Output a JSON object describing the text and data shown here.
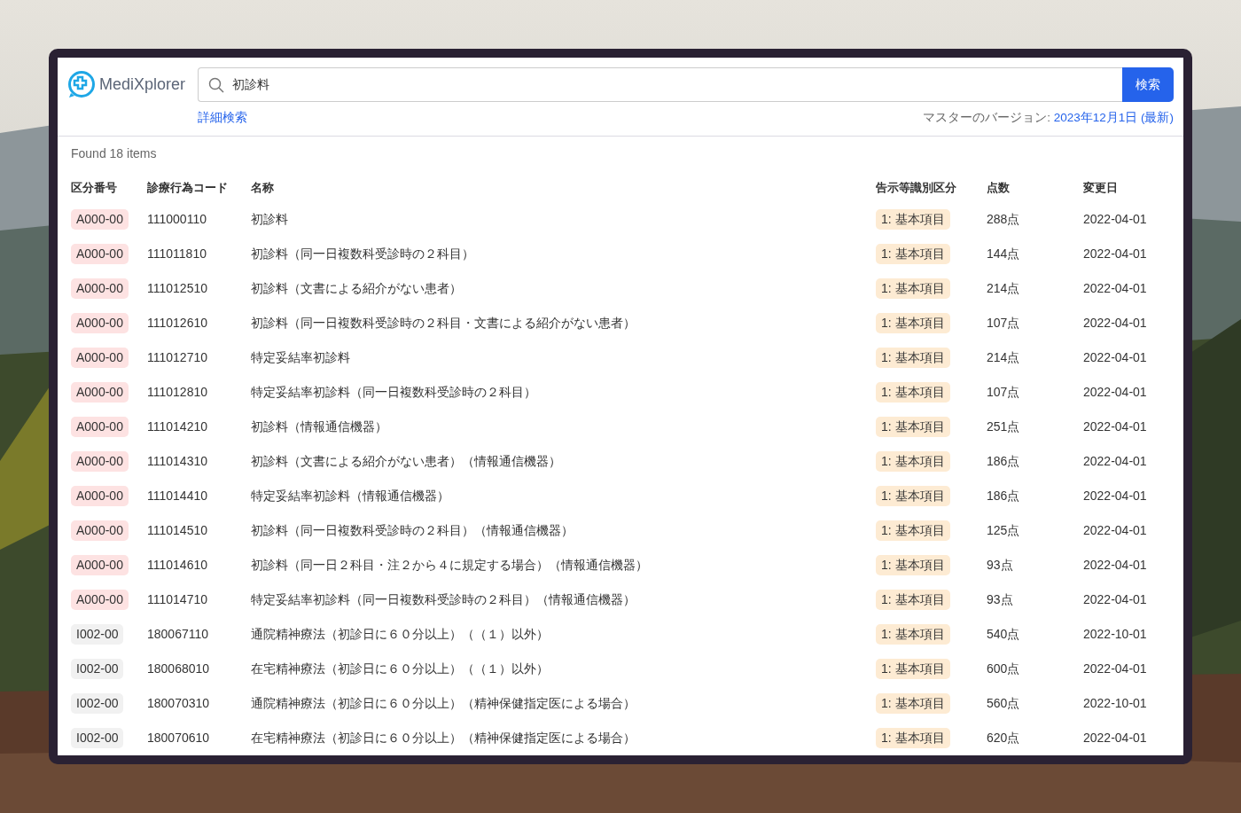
{
  "header": {
    "logo_text": "MediXplorer",
    "search": {
      "value": "初診料"
    },
    "search_button": "検索",
    "advanced_link": "詳細検索",
    "version_label": "マスターのバージョン: ",
    "version_link": "2023年12月1日 (最新)"
  },
  "result_count": "Found 18 items",
  "table": {
    "columns": [
      "区分番号",
      "診療行為コード",
      "名称",
      "告示等識別区分",
      "点数",
      "変更日"
    ],
    "rows": [
      {
        "section": "A000-00",
        "color": "#fde2e2",
        "code": "111000110",
        "name": "初診料",
        "category": "1: 基本項目",
        "points": "288点",
        "changed": "2022-04-01"
      },
      {
        "section": "A000-00",
        "color": "#fde2e2",
        "code": "111011810",
        "name": "初診料（同一日複数科受診時の２科目）",
        "category": "1: 基本項目",
        "points": "144点",
        "changed": "2022-04-01"
      },
      {
        "section": "A000-00",
        "color": "#fde2e2",
        "code": "111012510",
        "name": "初診料（文書による紹介がない患者）",
        "category": "1: 基本項目",
        "points": "214点",
        "changed": "2022-04-01"
      },
      {
        "section": "A000-00",
        "color": "#fde2e2",
        "code": "111012610",
        "name": "初診料（同一日複数科受診時の２科目・文書による紹介がない患者）",
        "category": "1: 基本項目",
        "points": "107点",
        "changed": "2022-04-01"
      },
      {
        "section": "A000-00",
        "color": "#fde2e2",
        "code": "111012710",
        "name": "特定妥結率初診料",
        "category": "1: 基本項目",
        "points": "214点",
        "changed": "2022-04-01"
      },
      {
        "section": "A000-00",
        "color": "#fde2e2",
        "code": "111012810",
        "name": "特定妥結率初診料（同一日複数科受診時の２科目）",
        "category": "1: 基本項目",
        "points": "107点",
        "changed": "2022-04-01"
      },
      {
        "section": "A000-00",
        "color": "#fde2e2",
        "code": "111014210",
        "name": "初診料（情報通信機器）",
        "category": "1: 基本項目",
        "points": "251点",
        "changed": "2022-04-01"
      },
      {
        "section": "A000-00",
        "color": "#fde2e2",
        "code": "111014310",
        "name": "初診料（文書による紹介がない患者）（情報通信機器）",
        "category": "1: 基本項目",
        "points": "186点",
        "changed": "2022-04-01"
      },
      {
        "section": "A000-00",
        "color": "#fde2e2",
        "code": "111014410",
        "name": "特定妥結率初診料（情報通信機器）",
        "category": "1: 基本項目",
        "points": "186点",
        "changed": "2022-04-01"
      },
      {
        "section": "A000-00",
        "color": "#fde2e2",
        "code": "111014510",
        "name": "初診料（同一日複数科受診時の２科目）（情報通信機器）",
        "category": "1: 基本項目",
        "points": "125点",
        "changed": "2022-04-01"
      },
      {
        "section": "A000-00",
        "color": "#fde2e2",
        "code": "111014610",
        "name": "初診料（同一日２科目・注２から４に規定する場合）（情報通信機器）",
        "category": "1: 基本項目",
        "points": "93点",
        "changed": "2022-04-01"
      },
      {
        "section": "A000-00",
        "color": "#fde2e2",
        "code": "111014710",
        "name": "特定妥結率初診料（同一日複数科受診時の２科目）（情報通信機器）",
        "category": "1: 基本項目",
        "points": "93点",
        "changed": "2022-04-01"
      },
      {
        "section": "I002-00",
        "color": "#f1f1f1",
        "code": "180067110",
        "name": "通院精神療法（初診日に６０分以上）（（１）以外）",
        "category": "1: 基本項目",
        "points": "540点",
        "changed": "2022-10-01"
      },
      {
        "section": "I002-00",
        "color": "#f1f1f1",
        "code": "180068010",
        "name": "在宅精神療法（初診日に６０分以上）（（１）以外）",
        "category": "1: 基本項目",
        "points": "600点",
        "changed": "2022-04-01"
      },
      {
        "section": "I002-00",
        "color": "#f1f1f1",
        "code": "180070310",
        "name": "通院精神療法（初診日に６０分以上）（精神保健指定医による場合）",
        "category": "1: 基本項目",
        "points": "560点",
        "changed": "2022-10-01"
      },
      {
        "section": "I002-00",
        "color": "#f1f1f1",
        "code": "180070610",
        "name": "在宅精神療法（初診日に６０分以上）（精神保健指定医による場合）",
        "category": "1: 基本項目",
        "points": "620点",
        "changed": "2022-04-01"
      }
    ]
  }
}
